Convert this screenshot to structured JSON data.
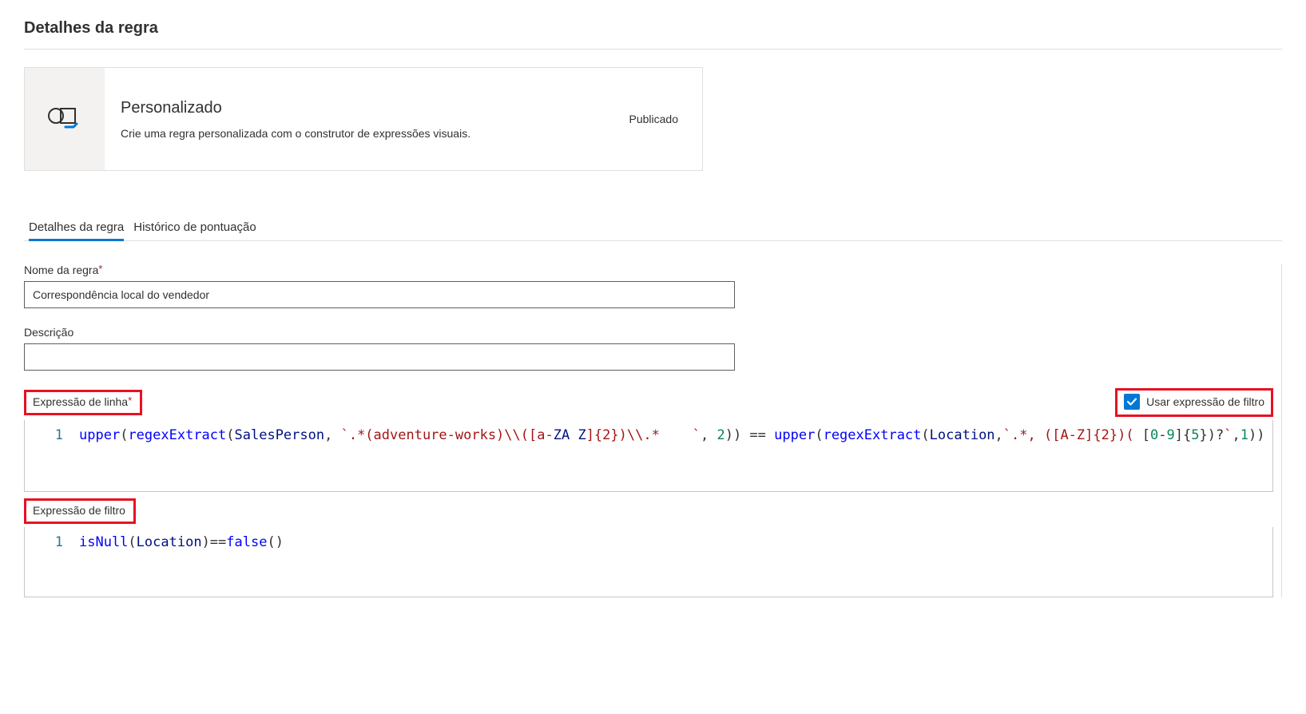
{
  "page_title": "Detalhes da regra",
  "card": {
    "title": "Personalizado",
    "description": "Crie uma regra personalizada com o construtor de expressões visuais.",
    "status": "Publicado"
  },
  "tabs": {
    "active": "Detalhes da regra",
    "other": "Histórico de pontuação"
  },
  "fields": {
    "rule_name_label": "Nome da regra",
    "rule_name_value": "Correspondência local do vendedor",
    "description_label": "Descrição",
    "description_value": ""
  },
  "row_expression": {
    "label": "Expressão de linha",
    "line1_number": "1",
    "code_tokens": [
      {
        "t": "fn",
        "v": "upper"
      },
      {
        "t": "op",
        "v": "("
      },
      {
        "t": "fn",
        "v": "regexExtract"
      },
      {
        "t": "op",
        "v": "("
      },
      {
        "t": "id",
        "v": "SalesPerson"
      },
      {
        "t": "op",
        "v": ", "
      },
      {
        "t": "str",
        "v": "`.*(adventure-works)\\\\([a-"
      },
      {
        "t": "id",
        "v": "ZA"
      },
      {
        "t": "op",
        "v": " "
      },
      {
        "t": "id",
        "v": "Z"
      },
      {
        "t": "str",
        "v": "]{2})\\\\.*    `"
      },
      {
        "t": "op",
        "v": ", "
      },
      {
        "t": "num",
        "v": "2"
      },
      {
        "t": "op",
        "v": ")) == "
      },
      {
        "t": "fn",
        "v": "upper"
      },
      {
        "t": "op",
        "v": "("
      },
      {
        "t": "fn",
        "v": "regexExtract"
      },
      {
        "t": "op",
        "v": "("
      },
      {
        "t": "id",
        "v": "Location"
      },
      {
        "t": "op",
        "v": ","
      },
      {
        "t": "str",
        "v": "`.*, ([A-Z]{2})( "
      },
      {
        "t": "op",
        "v": "["
      },
      {
        "t": "num",
        "v": "0"
      },
      {
        "t": "op",
        "v": "-"
      },
      {
        "t": "num",
        "v": "9"
      },
      {
        "t": "op",
        "v": "]{"
      },
      {
        "t": "num",
        "v": "5"
      },
      {
        "t": "op",
        "v": "})?"
      },
      {
        "t": "str",
        "v": "`"
      },
      {
        "t": "op",
        "v": ","
      },
      {
        "t": "num",
        "v": "1"
      },
      {
        "t": "op",
        "v": "))"
      }
    ]
  },
  "filter_toggle": {
    "label": "Usar expressão de filtro",
    "checked": true
  },
  "filter_expression": {
    "label": "Expressão de filtro",
    "line1_number": "1",
    "code_tokens": [
      {
        "t": "fn",
        "v": "isNull"
      },
      {
        "t": "op",
        "v": "("
      },
      {
        "t": "id",
        "v": "Location"
      },
      {
        "t": "op",
        "v": ")=="
      },
      {
        "t": "kw",
        "v": "false"
      },
      {
        "t": "op",
        "v": "()"
      }
    ]
  }
}
